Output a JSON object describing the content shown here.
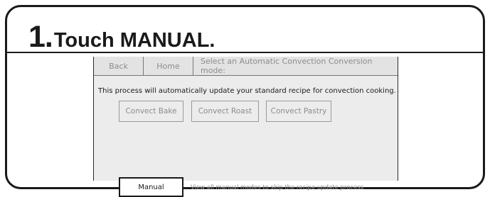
{
  "step": {
    "number": "1.",
    "text": "Touch MANUAL."
  },
  "nav": {
    "back_label": "Back",
    "home_label": "Home",
    "prompt": "Select an Automatic Convection Conversion mode:"
  },
  "main": {
    "description": "This process will automatically update your standard recipe for convection cooking.",
    "modes": [
      {
        "label": "Convect Bake"
      },
      {
        "label": "Convect Roast"
      },
      {
        "label": "Convect Pastry"
      }
    ],
    "manual": {
      "label": "Manual",
      "hint": "View all manual modes to skip the recipe update process"
    }
  },
  "colors": {
    "frame": "#1a1a1a",
    "screen_bg": "#ececec",
    "disabled_text": "#8c8c8c"
  }
}
